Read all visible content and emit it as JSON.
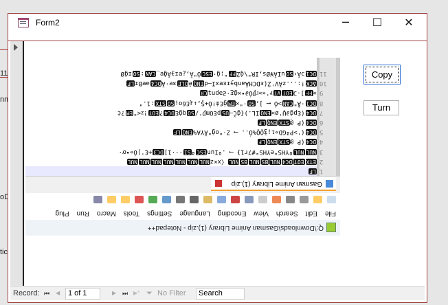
{
  "background_fragments": [
    "11",
    "nm",
    "oD",
    "tic"
  ],
  "window": {
    "title": "Form2",
    "minimize": "─",
    "maximize": "☐",
    "close": "✕"
  },
  "buttons": {
    "copy": "Copy",
    "turn": "Turn"
  },
  "image": {
    "title": "Q:\\Downloads\\Gasman Anime Library (1).zip - Notepad++",
    "menu": [
      "File",
      "Edit",
      "Search",
      "View",
      "Encoding",
      "Language",
      "Settings",
      "Tools",
      "Macro",
      "Run",
      "Plug"
    ],
    "tab": "Gasman Anime Library (1).zip",
    "line_numbers": [
      "1",
      "2",
      "3",
      "4",
      "5",
      "6",
      "7",
      "8",
      "9",
      "10",
      "11"
    ],
    "lines": [
      [
        {
          "c": "LF"
        }
      ],
      [
        {
          "c": "ETX"
        },
        {
          "c": "EOT"
        },
        {
          "c": "DC4"
        },
        {
          "c": "NUL"
        },
        {
          "c": "BS"
        },
        {
          "c": "NUL"
        },
        {
          "c": "BS"
        },
        {
          "c": "NUL"
        },
        {
          "t": "〈x×z"
        },
        {
          "c": "NUL"
        },
        {
          "c": "NUL"
        },
        {
          "c": "NUL"
        },
        {
          "c": "NUL"
        },
        {
          "c": "NUL"
        },
        {
          "c": "NUL"
        },
        {
          "c": "NUL"
        }
      ],
      [
        {
          "c": "NUL"
        },
        {
          "c": "NUL"
        },
        {
          "t": "ºYHS°eYHS°#7r1} ⟶ .ºIun"
        },
        {
          "c": "ESC"
        },
        {
          "t": "ª"
        },
        {
          "c": "SI"
        },
        {
          "t": "···1]"
        },
        {
          "c": "DC3"
        },
        {
          "t": "+Ɛ'|Ó»•ơ·"
        }
      ],
      [
        {
          "c": "DC4"
        },
        {
          "t": "(P @"
        },
        {
          "c": "STX"
        },
        {
          "c": "ENQ"
        },
        {
          "c": "LF"
        }
      ],
      [
        {
          "c": "DC4"
        },
        {
          "t": "('>PªGD»ı¡ǯǪǪ%Ó.. ⟶ Z·°oǵ°ĂYA%"
        },
        {
          "c": "ENQ"
        },
        {
          "c": "LF"
        }
      ],
      [
        {
          "c": "DC4"
        },
        {
          "t": "(P @"
        },
        {
          "c": "STX"
        },
        {
          "c": "ENQ"
        },
        {
          "c": "LF"
        }
      ],
      [
        {
          "c": "DC4"
        },
        {
          "t": "(Ɛpǵ∂Ų'ø»"
        },
        {
          "c": "ENQ"
        },
        {
          "t": "IL.){ǵČ—"
        },
        {
          "c": "US"
        },
        {
          "t": "pƐOmǷ'/"
        },
        {
          "c": "SO"
        },
        {
          "t": "qǵƐ"
        },
        {
          "c": "DC4"
        },
        {
          "t": "?"
        },
        {
          "c": "EOT"
        },
        {
          "t": "!ᴢ<\""
        },
        {
          "c": "EM"
        },
        {
          "t": "?ċ"
        }
      ],
      [
        {
          "c": "DC1"
        },
        {
          "t": "·Å\""
        },
        {
          "c": "CAN"
        },
        {
          "t": ">Ó ⟵ ],"
        },
        {
          "c": "SO"
        },
        {
          "t": "·\"×"
        },
        {
          "c": "EM"
        },
        {
          "t": "ǵƐȸ!Ò+Ş,↓ɻƐ6o¡"
        },
        {
          "c": "SO"
        },
        {
          "c": "STX"
        },
        {
          "t": ":1.\""
        }
      ],
      [
        {
          "t": "»"
        },
        {
          "c": "FF"
        },
        {
          "t": "]-Ɔ"
        },
        {
          "c": "EOT"
        },
        {
          "c": "VT"
        },
        {
          "t": "ᴘ'«»ᴦǷÓ∂•×ǵƹ·Ƨǝpnʇ"
        },
        {
          "c": "CR"
        }
      ],
      [
        {
          "c": "ACK"
        },
        {
          "t": "!:...zĂV'Ź(ɛDCHĂanbɟɪɛɐxI—d"
        },
        {
          "c": "ENQ"
        },
        {
          "t": "ê"
        },
        {
          "c": "DLE"
        },
        {
          "t": "ɜɐ·Ă"
        },
        {
          "c": "DC4"
        },
        {
          "t": "ǝɐBɪ"
        },
        {
          "c": "LF"
        }
      ],
      [
        {
          "c": "DC1"
        },
        {
          "t": "ɔĂ›"
        },
        {
          "c": "SO"
        },
        {
          "t": "uIĂ¥Øs,IR\"\\ǵŹ"
        },
        {
          "c": "FF"
        },
        {
          "t": "\";ǵ·"
        },
        {
          "c": "ESC"
        },
        {
          "t": "Ò\"Ă,¿ɐɪɟĂǵɐ_"
        },
        {
          "c": "CAN"
        },
        {
          "t": ":"
        },
        {
          "c": "SO"
        },
        {
          "t": "ɪǵØ"
        }
      ]
    ]
  },
  "record_bar": {
    "label": "Record:",
    "first": "⏮",
    "prev": "◀",
    "position": "1 of 1",
    "next": "▶",
    "last": "⏭",
    "new": "▶*",
    "filter": "No Filter",
    "search_placeholder": "Search"
  }
}
